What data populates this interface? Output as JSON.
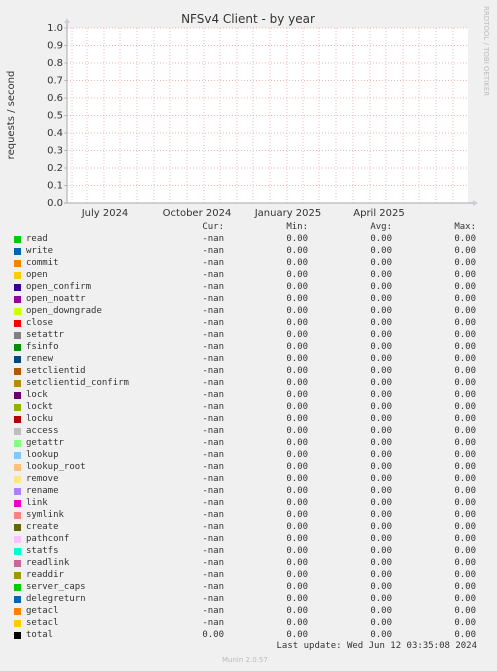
{
  "chart_data": {
    "type": "line",
    "title": "NFSv4 Client - by year",
    "ylabel": "requests / second",
    "xlabel": "",
    "y_ticks": [
      "0.0",
      "0.1",
      "0.2",
      "0.3",
      "0.4",
      "0.5",
      "0.6",
      "0.7",
      "0.8",
      "0.9",
      "1.0"
    ],
    "ylim": [
      0,
      1
    ],
    "x_ticks": [
      "July 2024",
      "October 2024",
      "January 2025",
      "April 2025"
    ],
    "grid": true,
    "series": []
  },
  "side_text": "RRDTOOL / TOBI OETIKER",
  "legend_headers": {
    "cur": "Cur:",
    "min": "Min:",
    "avg": "Avg:",
    "max": "Max:"
  },
  "legend": [
    {
      "name": "read",
      "color": "#00cc00",
      "cur": "-nan",
      "min": "0.00",
      "avg": "0.00",
      "max": "0.00"
    },
    {
      "name": "write",
      "color": "#0066b3",
      "cur": "-nan",
      "min": "0.00",
      "avg": "0.00",
      "max": "0.00"
    },
    {
      "name": "commit",
      "color": "#ff8000",
      "cur": "-nan",
      "min": "0.00",
      "avg": "0.00",
      "max": "0.00"
    },
    {
      "name": "open",
      "color": "#ffcc00",
      "cur": "-nan",
      "min": "0.00",
      "avg": "0.00",
      "max": "0.00"
    },
    {
      "name": "open_confirm",
      "color": "#330099",
      "cur": "-nan",
      "min": "0.00",
      "avg": "0.00",
      "max": "0.00"
    },
    {
      "name": "open_noattr",
      "color": "#990099",
      "cur": "-nan",
      "min": "0.00",
      "avg": "0.00",
      "max": "0.00"
    },
    {
      "name": "open_downgrade",
      "color": "#ccff00",
      "cur": "-nan",
      "min": "0.00",
      "avg": "0.00",
      "max": "0.00"
    },
    {
      "name": "close",
      "color": "#ff0000",
      "cur": "-nan",
      "min": "0.00",
      "avg": "0.00",
      "max": "0.00"
    },
    {
      "name": "setattr",
      "color": "#808080",
      "cur": "-nan",
      "min": "0.00",
      "avg": "0.00",
      "max": "0.00"
    },
    {
      "name": "fsinfo",
      "color": "#008f00",
      "cur": "-nan",
      "min": "0.00",
      "avg": "0.00",
      "max": "0.00"
    },
    {
      "name": "renew",
      "color": "#00487d",
      "cur": "-nan",
      "min": "0.00",
      "avg": "0.00",
      "max": "0.00"
    },
    {
      "name": "setclientid",
      "color": "#b35a00",
      "cur": "-nan",
      "min": "0.00",
      "avg": "0.00",
      "max": "0.00"
    },
    {
      "name": "setclientid_confirm",
      "color": "#b38f00",
      "cur": "-nan",
      "min": "0.00",
      "avg": "0.00",
      "max": "0.00"
    },
    {
      "name": "lock",
      "color": "#6b006b",
      "cur": "-nan",
      "min": "0.00",
      "avg": "0.00",
      "max": "0.00"
    },
    {
      "name": "lockt",
      "color": "#8fb300",
      "cur": "-nan",
      "min": "0.00",
      "avg": "0.00",
      "max": "0.00"
    },
    {
      "name": "locku",
      "color": "#b30000",
      "cur": "-nan",
      "min": "0.00",
      "avg": "0.00",
      "max": "0.00"
    },
    {
      "name": "access",
      "color": "#bebebe",
      "cur": "-nan",
      "min": "0.00",
      "avg": "0.00",
      "max": "0.00"
    },
    {
      "name": "getattr",
      "color": "#80ff80",
      "cur": "-nan",
      "min": "0.00",
      "avg": "0.00",
      "max": "0.00"
    },
    {
      "name": "lookup",
      "color": "#80c9ff",
      "cur": "-nan",
      "min": "0.00",
      "avg": "0.00",
      "max": "0.00"
    },
    {
      "name": "lookup_root",
      "color": "#ffc080",
      "cur": "-nan",
      "min": "0.00",
      "avg": "0.00",
      "max": "0.00"
    },
    {
      "name": "remove",
      "color": "#ffe680",
      "cur": "-nan",
      "min": "0.00",
      "avg": "0.00",
      "max": "0.00"
    },
    {
      "name": "rename",
      "color": "#aa80ff",
      "cur": "-nan",
      "min": "0.00",
      "avg": "0.00",
      "max": "0.00"
    },
    {
      "name": "link",
      "color": "#ee00cc",
      "cur": "-nan",
      "min": "0.00",
      "avg": "0.00",
      "max": "0.00"
    },
    {
      "name": "symlink",
      "color": "#ff8080",
      "cur": "-nan",
      "min": "0.00",
      "avg": "0.00",
      "max": "0.00"
    },
    {
      "name": "create",
      "color": "#666600",
      "cur": "-nan",
      "min": "0.00",
      "avg": "0.00",
      "max": "0.00"
    },
    {
      "name": "pathconf",
      "color": "#ffbfff",
      "cur": "-nan",
      "min": "0.00",
      "avg": "0.00",
      "max": "0.00"
    },
    {
      "name": "statfs",
      "color": "#00ffcc",
      "cur": "-nan",
      "min": "0.00",
      "avg": "0.00",
      "max": "0.00"
    },
    {
      "name": "readlink",
      "color": "#cc6699",
      "cur": "-nan",
      "min": "0.00",
      "avg": "0.00",
      "max": "0.00"
    },
    {
      "name": "readdir",
      "color": "#999900",
      "cur": "-nan",
      "min": "0.00",
      "avg": "0.00",
      "max": "0.00"
    },
    {
      "name": "server_caps",
      "color": "#00cc00",
      "cur": "-nan",
      "min": "0.00",
      "avg": "0.00",
      "max": "0.00"
    },
    {
      "name": "delegreturn",
      "color": "#0066b3",
      "cur": "-nan",
      "min": "0.00",
      "avg": "0.00",
      "max": "0.00"
    },
    {
      "name": "getacl",
      "color": "#ff8000",
      "cur": "-nan",
      "min": "0.00",
      "avg": "0.00",
      "max": "0.00"
    },
    {
      "name": "setacl",
      "color": "#ffcc00",
      "cur": "-nan",
      "min": "0.00",
      "avg": "0.00",
      "max": "0.00"
    },
    {
      "name": "total",
      "color": "#000000",
      "cur": "0.00",
      "min": "0.00",
      "avg": "0.00",
      "max": "0.00"
    }
  ],
  "last_update": "Last update: Wed Jun 12 03:35:08 2024",
  "generator": "Munin 2.0.57"
}
